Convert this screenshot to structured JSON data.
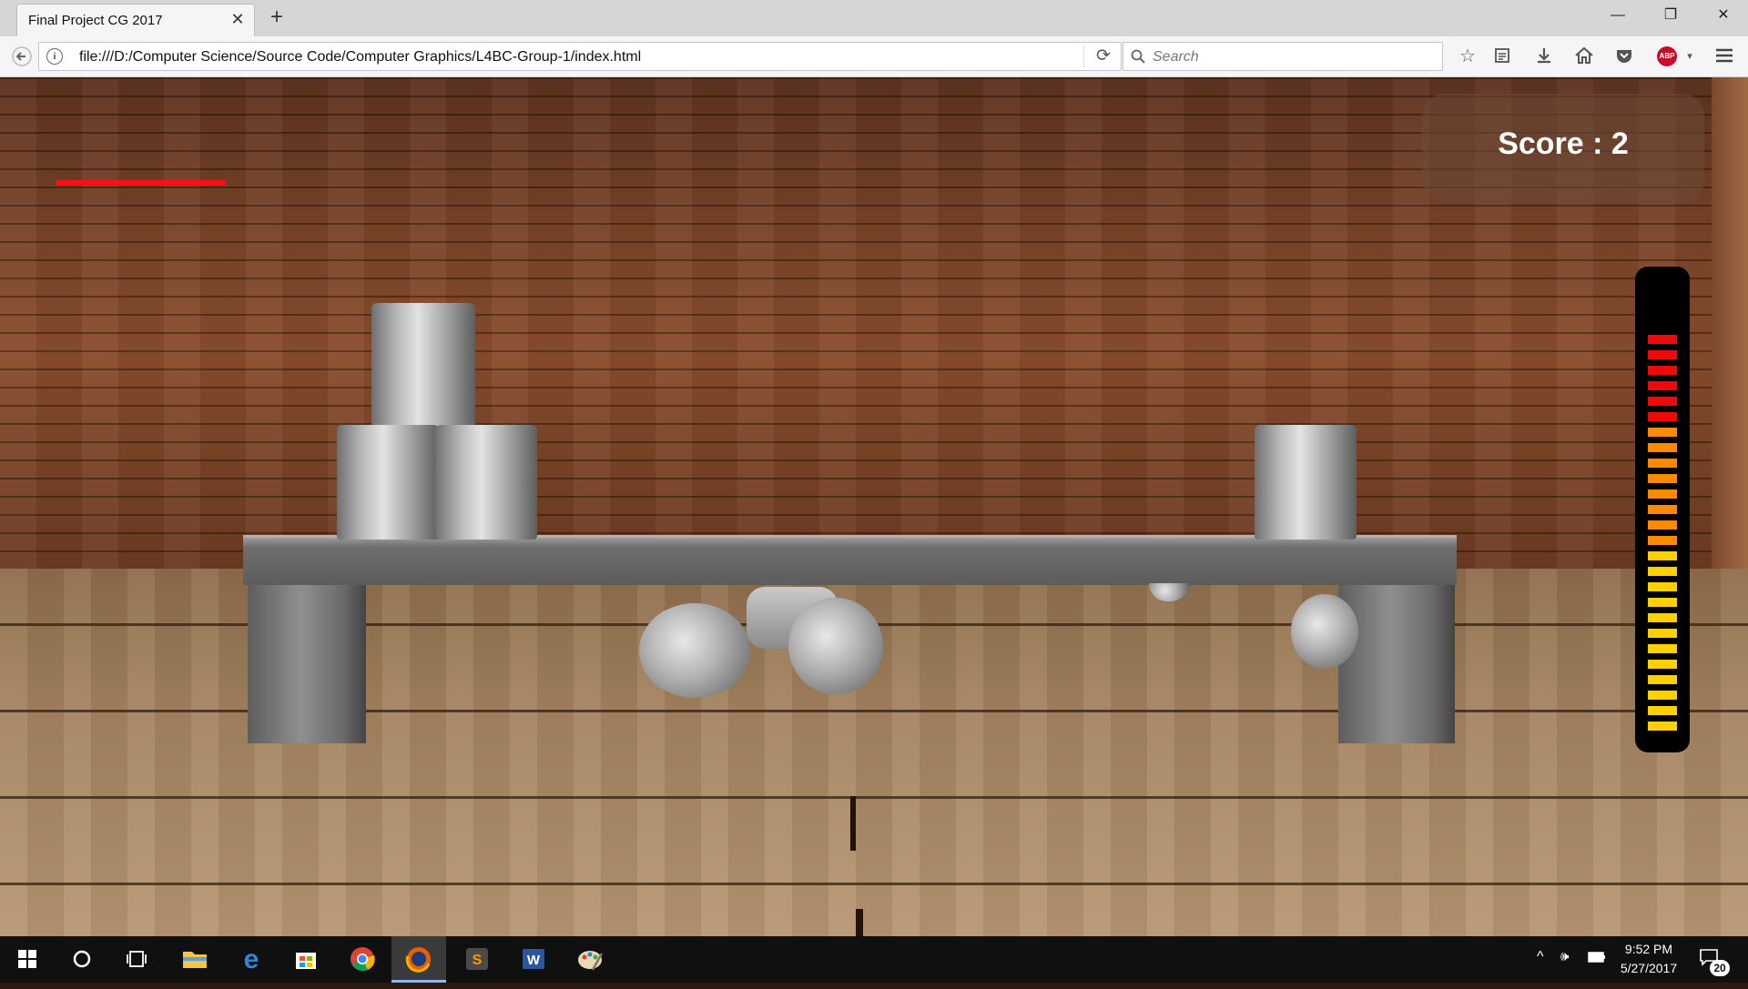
{
  "browser": {
    "tab_title": "Final Project CG 2017",
    "tab_close": "✕",
    "new_tab": "+",
    "url": "file:///D:/Computer Science/Source Code/Computer Graphics/L4BC-Group-1/index.html",
    "search_placeholder": "Search",
    "window_controls": {
      "minimize": "—",
      "restore": "❐",
      "close": "✕"
    },
    "toolbar_icons": [
      "back-arrow-icon",
      "bookmark-star-icon",
      "reading-list-icon",
      "download-icon",
      "home-icon",
      "pocket-icon",
      "adblock-plus-icon",
      "menu-icon"
    ],
    "abp_label": "ABP"
  },
  "game": {
    "score_text": "Score : 2",
    "hud_bar_color": "#ff1010",
    "power_meter": {
      "segments": 26,
      "filled_fraction": 1.0,
      "colors": {
        "low": "#ffd000",
        "mid": "#ff8a00",
        "high": "#ee0a0a"
      }
    }
  },
  "taskbar": {
    "apps": [
      "windows-start-icon",
      "cortana-icon",
      "task-view-icon",
      "file-explorer-icon",
      "edge-icon",
      "store-icon",
      "chrome-icon",
      "firefox-icon",
      "sublime-text-icon",
      "word-icon",
      "paint-icon"
    ],
    "time": "9:52 PM",
    "date": "5/27/2017",
    "notification_count": "20"
  }
}
